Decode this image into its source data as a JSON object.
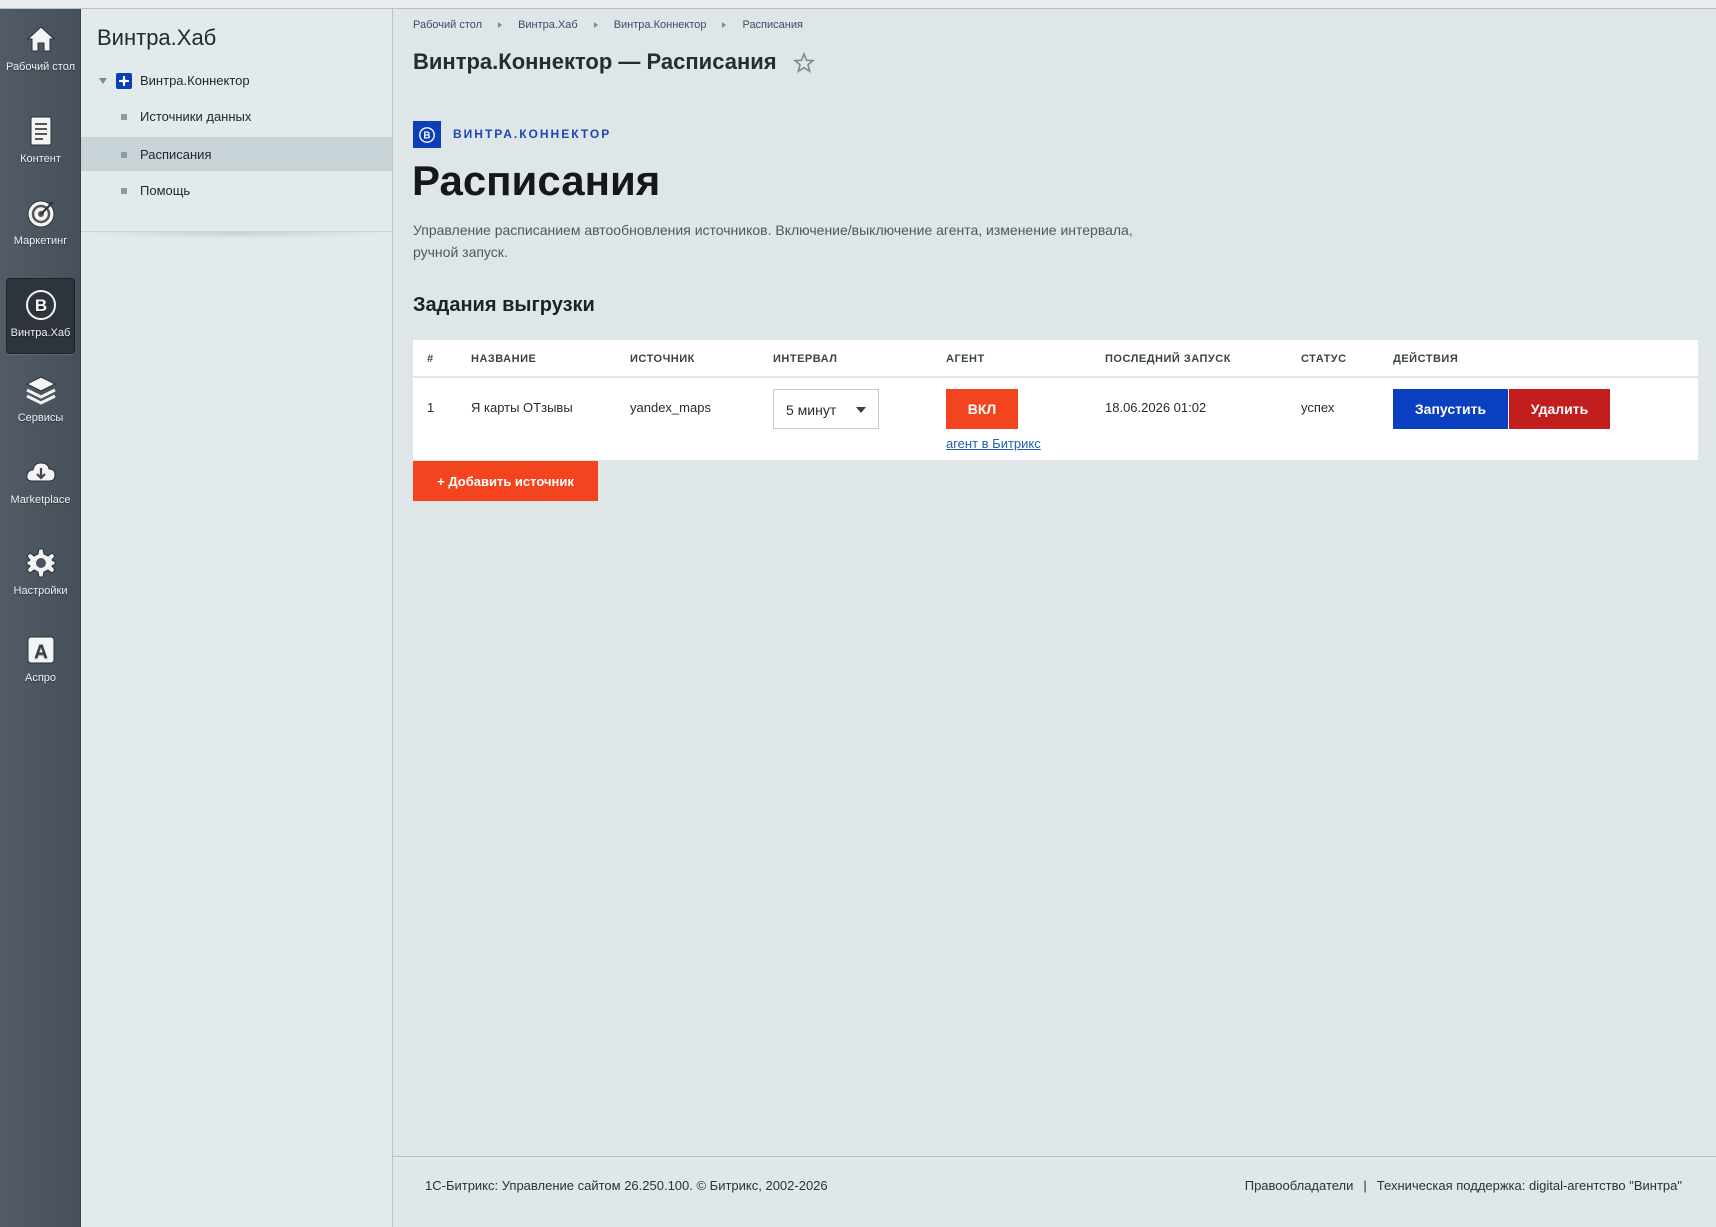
{
  "rail": {
    "items": [
      {
        "label": "Рабочий стол",
        "icon": "home-icon"
      },
      {
        "label": "Контент",
        "icon": "document-icon"
      },
      {
        "label": "Маркетинг",
        "icon": "target-icon"
      },
      {
        "label": "Винтра.Хаб",
        "icon": "vintra-logo-icon",
        "active": true
      },
      {
        "label": "Сервисы",
        "icon": "layers-icon"
      },
      {
        "label": "Marketplace",
        "icon": "cloud-download-icon"
      },
      {
        "label": "Настройки",
        "icon": "gear-icon"
      },
      {
        "label": "Аспро",
        "icon": "letter-a-icon"
      }
    ]
  },
  "menu": {
    "title": "Винтра.Хаб",
    "root": "Винтра.Коннектор",
    "items": [
      {
        "label": "Источники данных"
      },
      {
        "label": "Расписания",
        "active": true
      },
      {
        "label": "Помощь"
      }
    ]
  },
  "breadcrumb": [
    "Рабочий стол",
    "Винтра.Хаб",
    "Винтра.Коннектор",
    "Расписания"
  ],
  "page": {
    "title": "Винтра.Коннектор — Расписания",
    "brand_letter": "В",
    "brand": "ВИНТРА.КОННЕКТОР",
    "heading": "Расписания",
    "description": "Управление расписанием автообновления источников. Включение/выключение агента, изменение интервала, ручной запуск.",
    "section_title": "Задания выгрузки",
    "add_button": "+ Добавить источник"
  },
  "table": {
    "columns": [
      "#",
      "НАЗВАНИЕ",
      "ИСТОЧНИК",
      "ИНТЕРВАЛ",
      "АГЕНТ",
      "ПОСЛЕДНИЙ ЗАПУСК",
      "СТАТУС",
      "ДЕЙСТВИЯ"
    ],
    "rows": [
      {
        "num": "1",
        "name": "Я карты ОТзывы",
        "source": "yandex_maps",
        "interval": "5 минут",
        "agent_button": "ВКЛ",
        "agent_link": "агент в Битрикс",
        "last_run": "18.06.2026 01:02",
        "status": "успех",
        "run_button": "Запустить",
        "delete_button": "Удалить"
      }
    ]
  },
  "footer": {
    "copyright": "1С-Битрикс: Управление сайтом 26.250.100. © Битрикс, 2002-2026",
    "rights_link": "Правообладатели",
    "support": "Техническая поддержка: digital-агентство \"Винтра\""
  },
  "colors": {
    "accent_orange": "#f2441e",
    "primary_blue": "#0a3fc2",
    "danger_red": "#c21e1e",
    "brand_blue": "#1a47b5"
  }
}
